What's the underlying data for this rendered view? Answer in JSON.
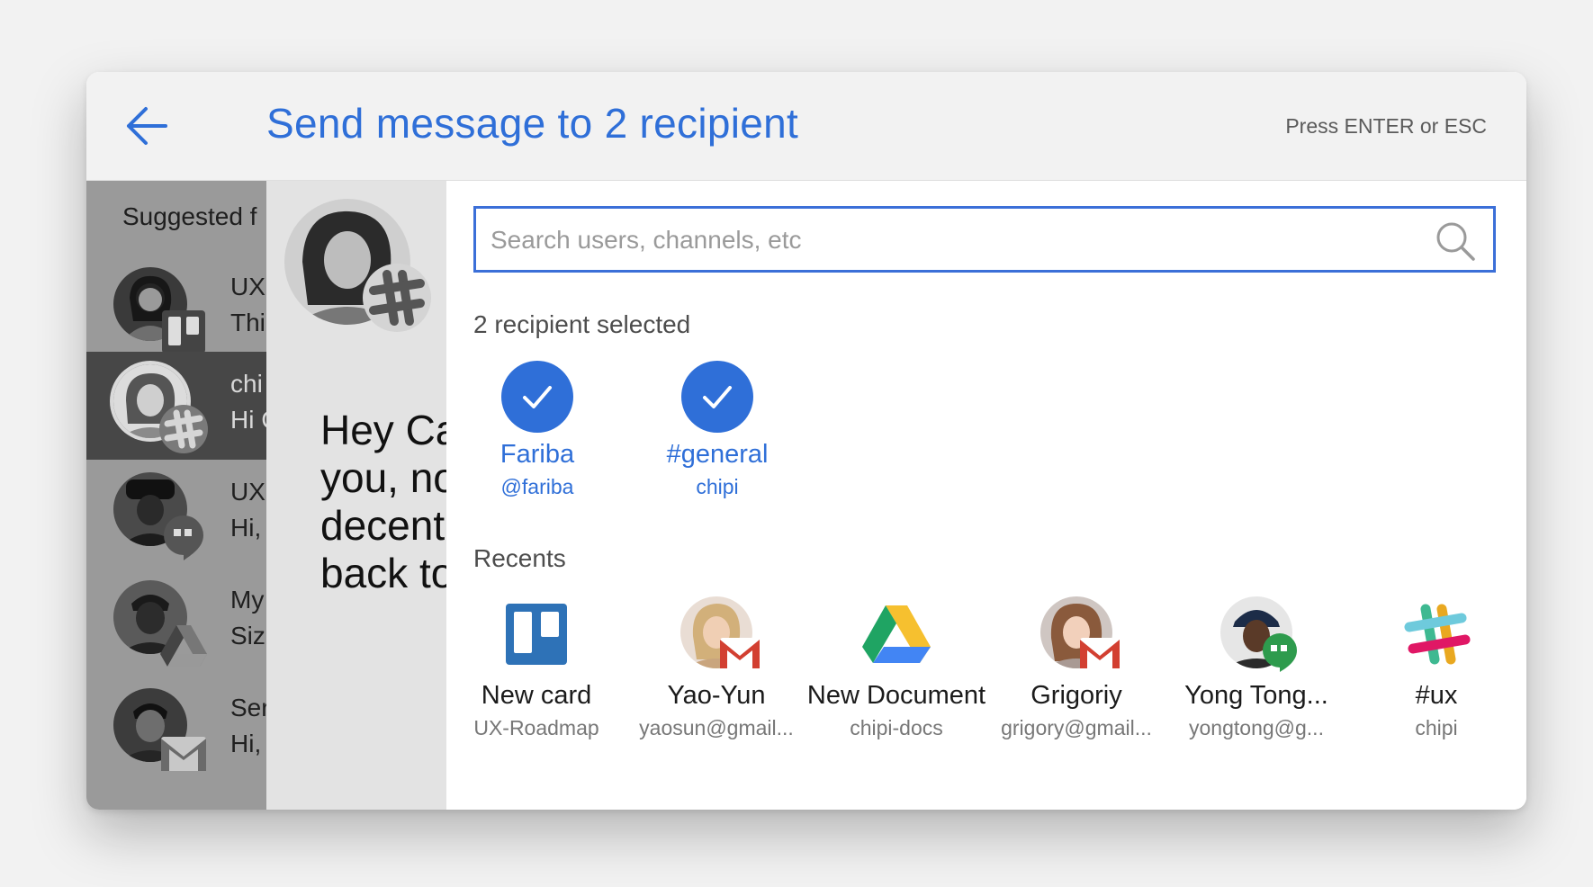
{
  "header": {
    "title": "Send message to 2 recipient",
    "hint": "Press ENTER or ESC"
  },
  "sidebar": {
    "heading": "Suggested f",
    "conversations": [
      {
        "line1": "UX-",
        "line2": "Thi",
        "badge": "trello-icon"
      },
      {
        "line1": "chi",
        "line2": "Hi C",
        "badge": "slack-icon",
        "selected": true
      },
      {
        "line1": "UX",
        "line2": "Hi,",
        "badge": "hangouts-icon"
      },
      {
        "line1": "My",
        "line2": "Siz",
        "badge": "drive-icon"
      },
      {
        "line1": "Ser",
        "line2": "Hi,",
        "badge": "gmail-icon"
      }
    ]
  },
  "message": {
    "lines": [
      "Hey Ca",
      "you, no",
      "decent",
      "back to"
    ]
  },
  "search": {
    "placeholder": "Search users, channels, etc",
    "value": ""
  },
  "selected_section": {
    "label": "2 recipient selected",
    "items": [
      {
        "name": "Fariba",
        "sub": "@fariba"
      },
      {
        "name": "#general",
        "sub": "chipi"
      }
    ]
  },
  "recents_section": {
    "label": "Recents",
    "items": [
      {
        "name": "New card",
        "sub": "UX-Roadmap",
        "icon": "trello-icon"
      },
      {
        "name": "Yao-Yun",
        "sub": "yaosun@gmail...",
        "icon": "gmail-icon"
      },
      {
        "name": "New Document",
        "sub": "chipi-docs",
        "icon": "google-drive-icon"
      },
      {
        "name": "Grigoriy",
        "sub": "grigory@gmail...",
        "icon": "gmail-icon"
      },
      {
        "name": "Yong Tong...",
        "sub": "yongtong@g...",
        "icon": "hangouts-icon"
      },
      {
        "name": "#ux",
        "sub": "chipi",
        "icon": "slack-icon"
      }
    ]
  },
  "colors": {
    "accent": "#2f6fd8",
    "header_bg": "#f2f2f2",
    "trello": "#2e72b7",
    "gmail_red": "#d23f31",
    "hangouts_green": "#2e9b4d"
  }
}
